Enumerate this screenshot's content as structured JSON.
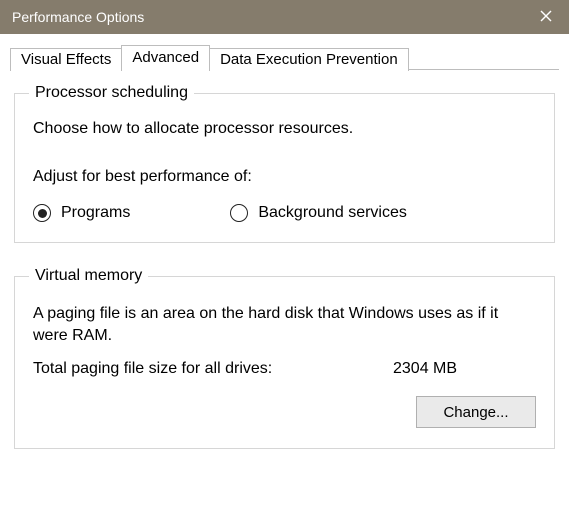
{
  "window": {
    "title": "Performance Options"
  },
  "tabs": {
    "visual_effects": "Visual Effects",
    "advanced": "Advanced",
    "dep": "Data Execution Prevention"
  },
  "processor": {
    "legend": "Processor scheduling",
    "desc": "Choose how to allocate processor resources.",
    "subhead": "Adjust for best performance of:",
    "option_programs": "Programs",
    "option_background": "Background services",
    "selected": "programs"
  },
  "virtual_memory": {
    "legend": "Virtual memory",
    "desc": "A paging file is an area on the hard disk that Windows uses as if it were RAM.",
    "total_label": "Total paging file size for all drives:",
    "total_value": "2304 MB",
    "change_button": "Change..."
  }
}
